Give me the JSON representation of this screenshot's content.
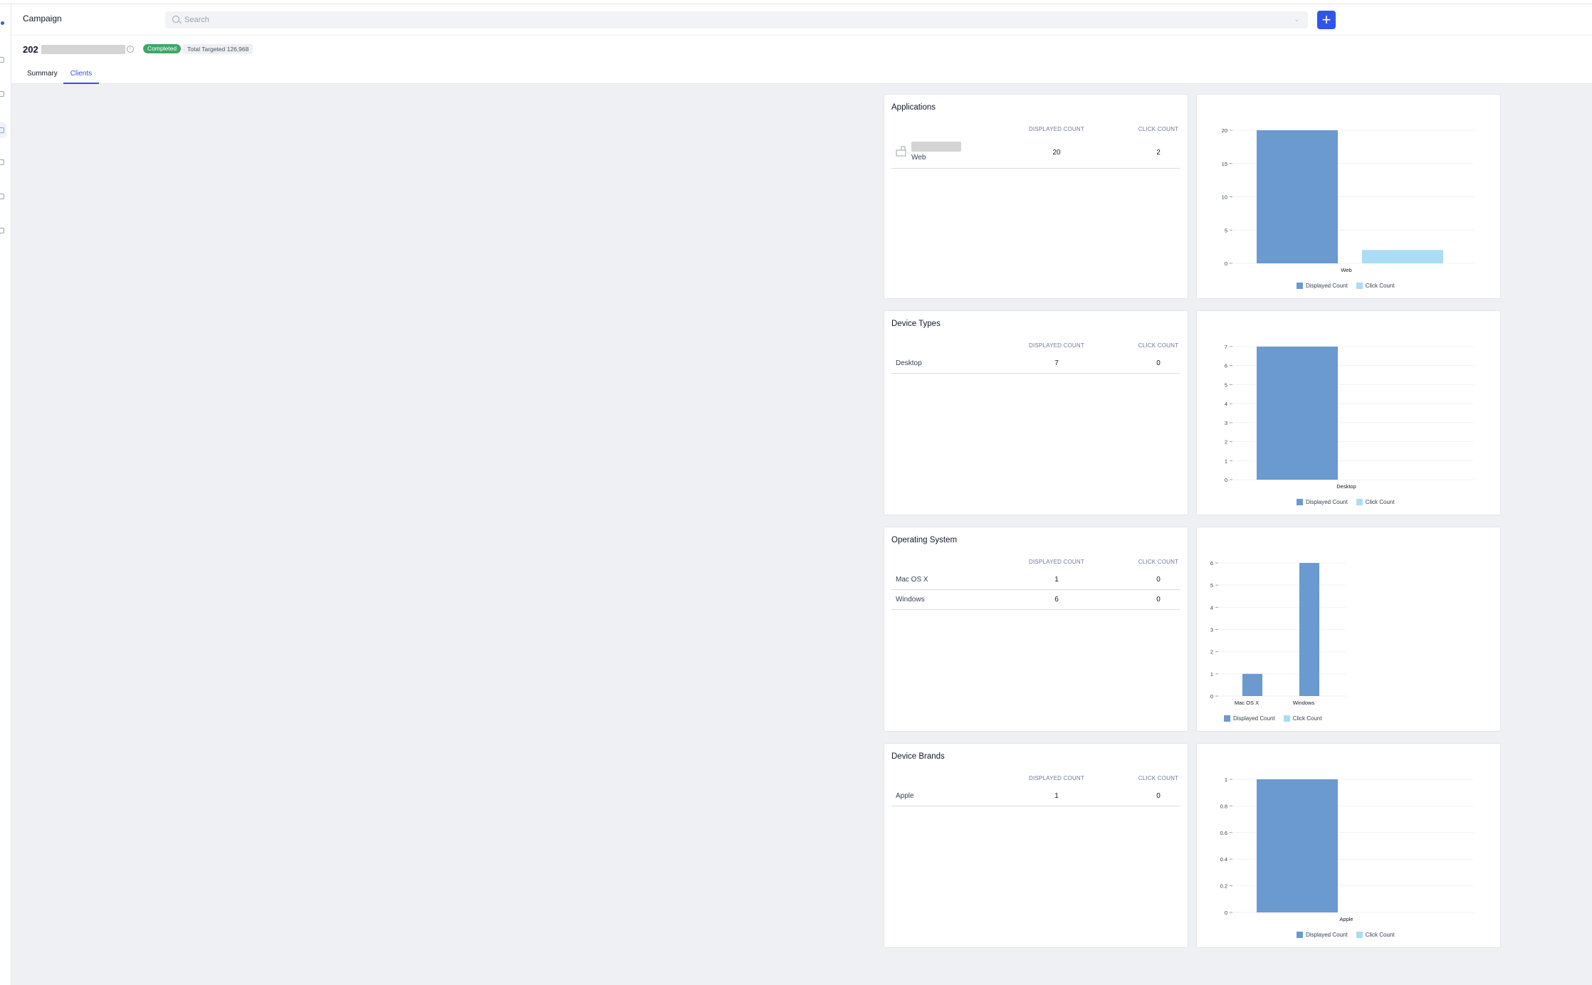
{
  "app": {
    "title": "Campaign"
  },
  "search": {
    "placeholder": "Search",
    "add_label": "+"
  },
  "campaign": {
    "name_prefix": "202",
    "status": "Completed",
    "targeted_label": "Total Targeted",
    "targeted_value": "126,968"
  },
  "tabs": [
    {
      "label": "Summary"
    },
    {
      "label": "Clients"
    }
  ],
  "colors": {
    "displayed": "#6a9ad0",
    "click": "#abdcf5",
    "accent": "#2f54eb",
    "completed": "#3fa66a"
  },
  "sections": [
    {
      "title": "Applications",
      "columns": [
        "DISPLAYED COUNT",
        "CLICK COUNT"
      ],
      "rows": [
        {
          "name": "Web",
          "displayed": "20",
          "click": "2"
        }
      ]
    },
    {
      "title": "Device Types",
      "columns": [
        "DISPLAYED COUNT",
        "CLICK COUNT"
      ],
      "rows": [
        {
          "name": "Desktop",
          "displayed": "7",
          "click": "0"
        }
      ]
    },
    {
      "title": "Operating System",
      "columns": [
        "DISPLAYED COUNT",
        "CLICK COUNT"
      ],
      "rows": [
        {
          "name": "Mac OS X",
          "displayed": "1",
          "click": "0"
        },
        {
          "name": "Windows",
          "displayed": "6",
          "click": "0"
        }
      ]
    },
    {
      "title": "Device Brands",
      "columns": [
        "DISPLAYED COUNT",
        "CLICK COUNT"
      ],
      "rows": [
        {
          "name": "Apple",
          "displayed": "1",
          "click": "0"
        }
      ]
    }
  ],
  "chart_data": [
    {
      "type": "bar",
      "categories": [
        "Web"
      ],
      "series": [
        {
          "name": "Displayed Count",
          "values": [
            20
          ]
        },
        {
          "name": "Click Count",
          "values": [
            2
          ]
        }
      ],
      "yticks": [
        "0",
        "5",
        "10",
        "15",
        "20"
      ],
      "ylim": [
        0,
        20
      ],
      "legend": "bottom"
    },
    {
      "type": "bar",
      "categories": [
        "Desktop"
      ],
      "series": [
        {
          "name": "Displayed Count",
          "values": [
            7
          ]
        },
        {
          "name": "Click Count",
          "values": [
            0
          ]
        }
      ],
      "yticks": [
        "0",
        "1",
        "2",
        "3",
        "4",
        "5",
        "6",
        "7"
      ],
      "ylim": [
        0,
        7
      ],
      "legend": "bottom"
    },
    {
      "type": "bar",
      "categories": [
        "Mac OS X",
        "Windows"
      ],
      "series": [
        {
          "name": "Displayed Count",
          "values": [
            1,
            6
          ]
        },
        {
          "name": "Click Count",
          "values": [
            0,
            0
          ]
        }
      ],
      "yticks": [
        "0",
        "1",
        "2",
        "3",
        "4",
        "5",
        "6"
      ],
      "ylim": [
        0,
        6
      ],
      "legend": "bottom"
    },
    {
      "type": "bar",
      "categories": [
        "Apple"
      ],
      "series": [
        {
          "name": "Displayed Count",
          "values": [
            1
          ]
        },
        {
          "name": "Click Count",
          "values": [
            0
          ]
        }
      ],
      "yticks": [
        "0",
        "0.2",
        "0.4",
        "0.6",
        "0.8",
        "1"
      ],
      "ylim": [
        0,
        1
      ],
      "legend": "bottom"
    }
  ]
}
